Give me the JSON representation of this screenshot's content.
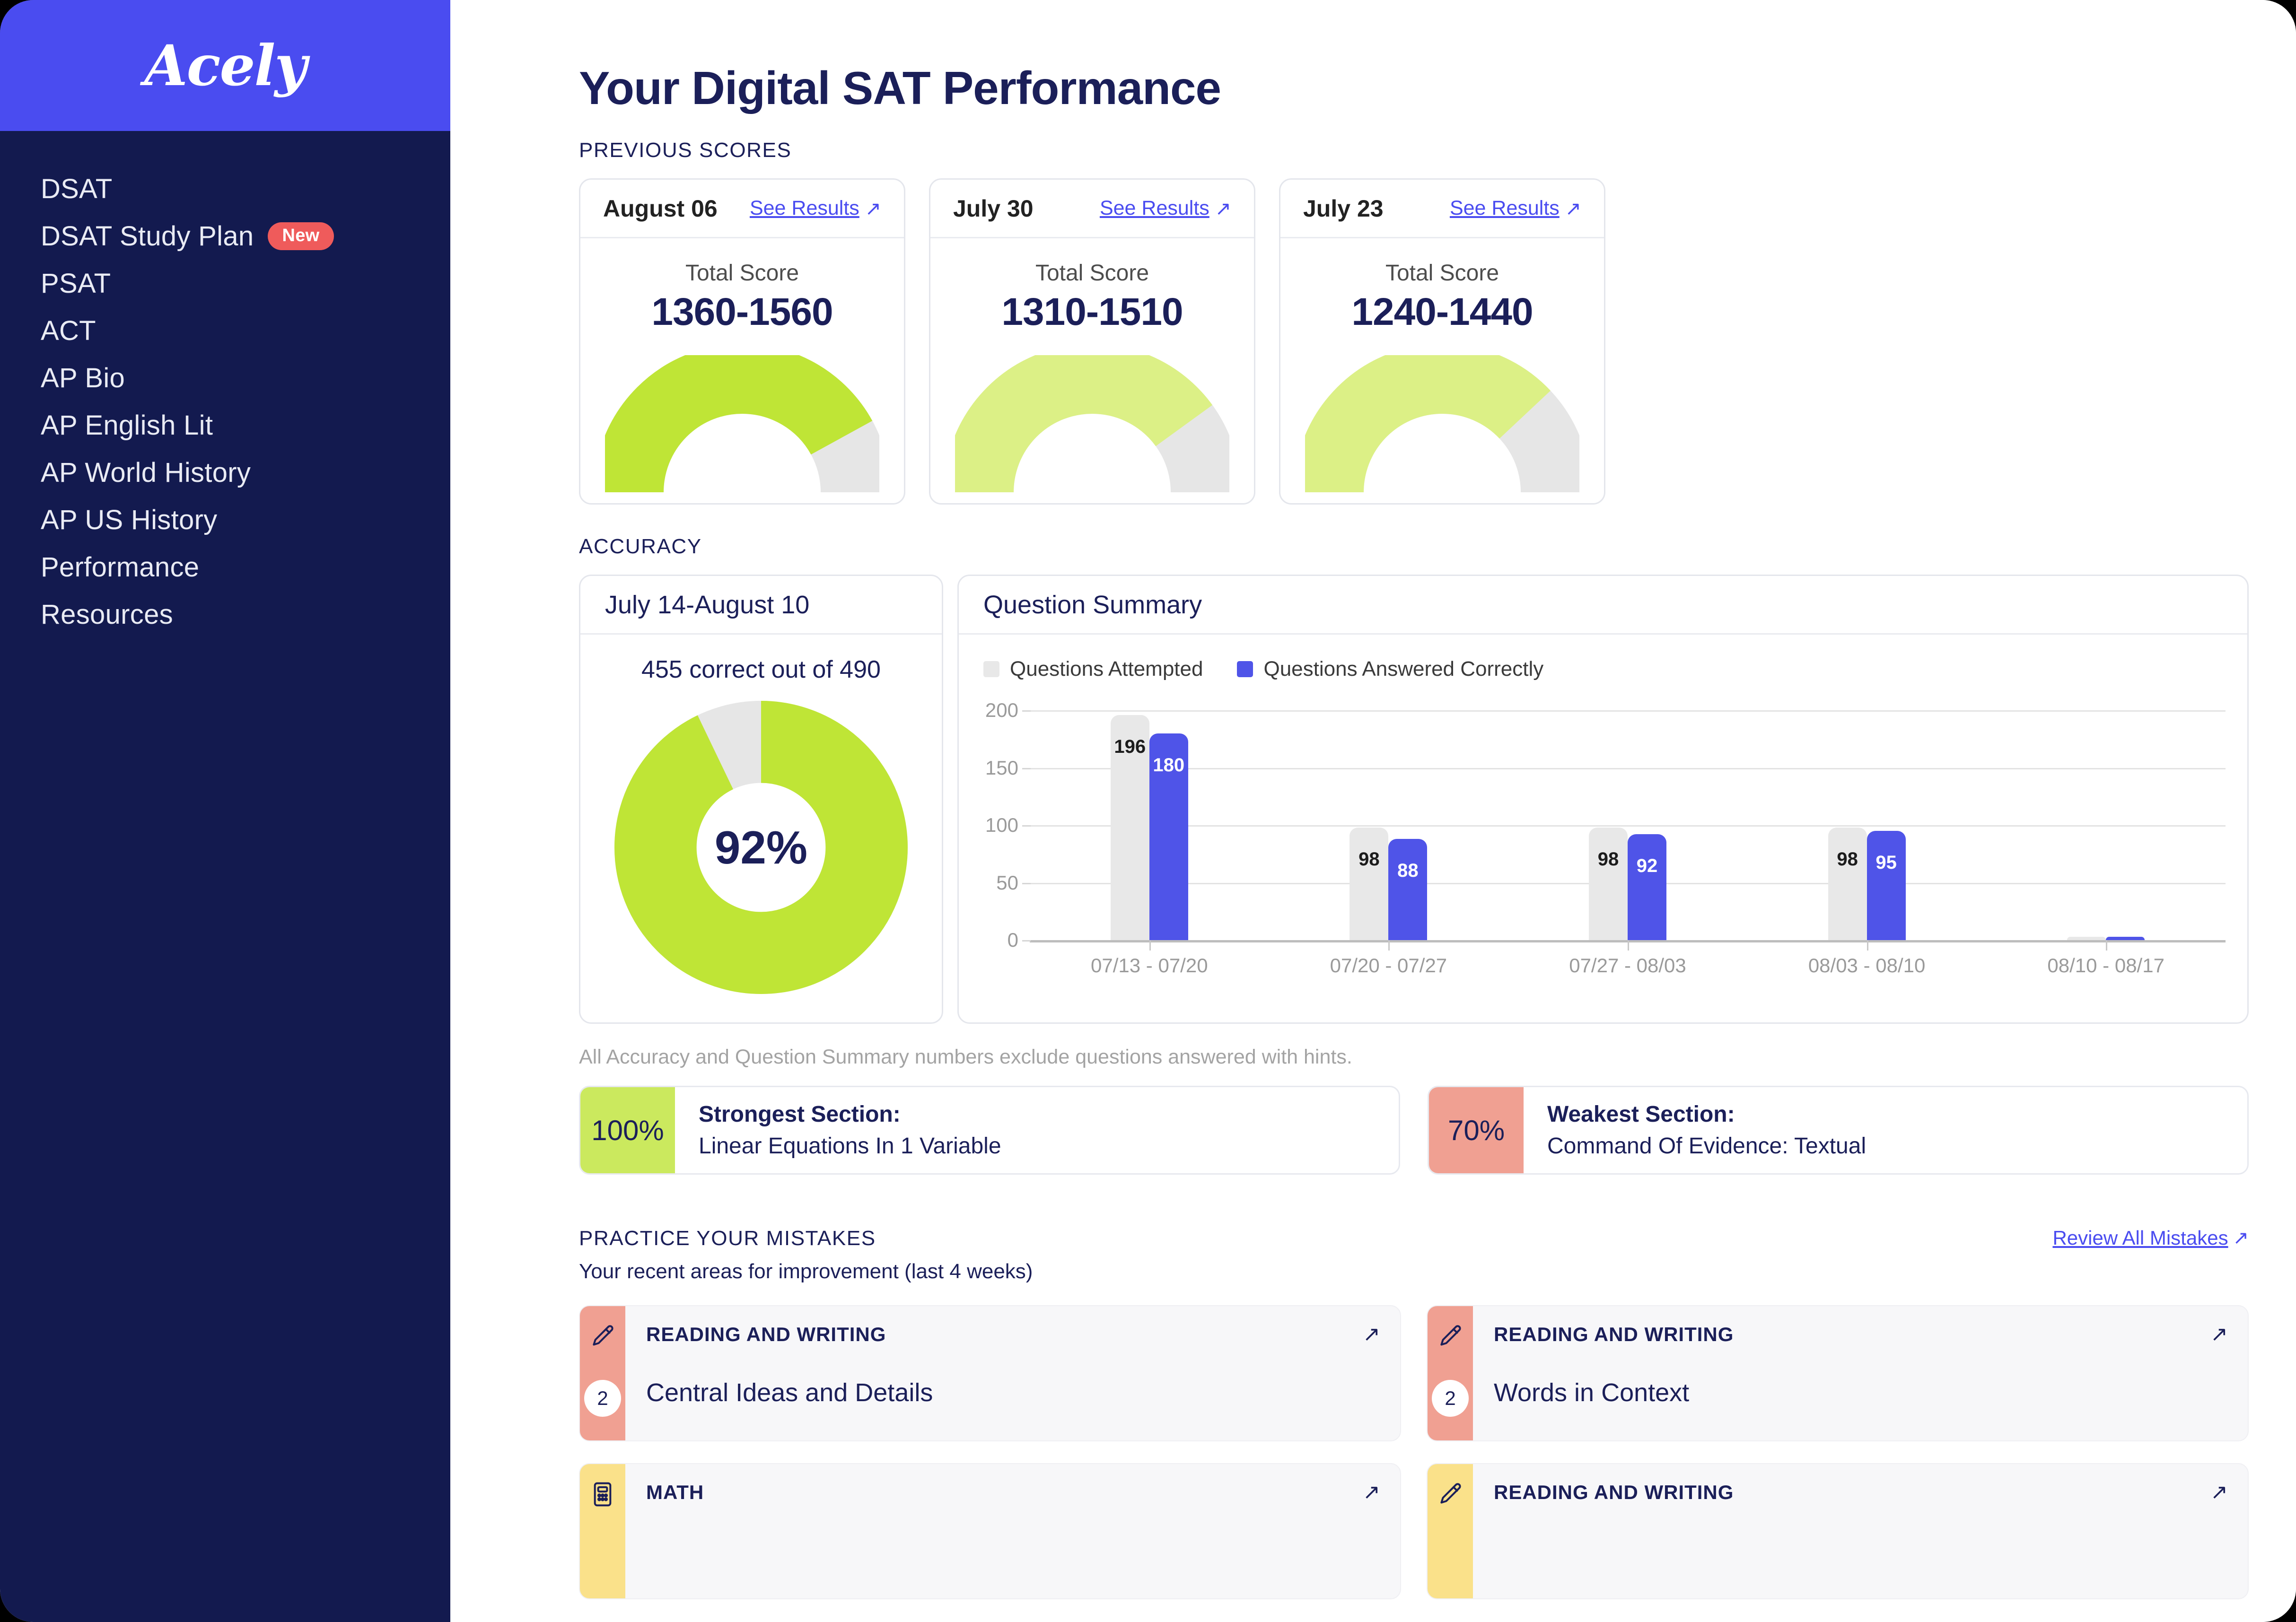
{
  "brand": {
    "logo_text": "Acely",
    "logo_bg": "#4A4CF0",
    "sidebar_bg": "#131A4F"
  },
  "sidebar": {
    "items": [
      {
        "label": "DSAT",
        "badge": null
      },
      {
        "label": "DSAT Study Plan",
        "badge": "New"
      },
      {
        "label": "PSAT",
        "badge": null
      },
      {
        "label": "ACT",
        "badge": null
      },
      {
        "label": "AP Bio",
        "badge": null
      },
      {
        "label": "AP English Lit",
        "badge": null
      },
      {
        "label": "AP World History",
        "badge": null
      },
      {
        "label": "AP US History",
        "badge": null
      },
      {
        "label": "Performance",
        "badge": null
      },
      {
        "label": "Resources",
        "badge": null
      }
    ]
  },
  "header": {
    "title": "Your Digital SAT Performance"
  },
  "previous_scores": {
    "label": "PREVIOUS SCORES",
    "see_results_label": "See Results",
    "total_score_label": "Total Score",
    "cards": [
      {
        "date": "August 06",
        "score": "1360-1560",
        "fill_pct": 84,
        "fill_color": "#BFE536"
      },
      {
        "date": "July 30",
        "score": "1310-1510",
        "fill_pct": 80,
        "fill_color": "#DCF086"
      },
      {
        "date": "July 23",
        "score": "1240-1440",
        "fill_pct": 76,
        "fill_color": "#DCF086"
      }
    ]
  },
  "accuracy": {
    "label": "ACCURACY",
    "date_range": "July 14-August 10",
    "summary": "455 correct out of 490",
    "percent": "92%",
    "correct": 455,
    "total": 490,
    "donut_color": "#BFE536",
    "donut_track": "#E6E6E6"
  },
  "question_summary": {
    "title": "Question Summary",
    "legend": [
      {
        "name": "Questions Attempted",
        "color": "#E8E8E8"
      },
      {
        "name": "Questions Answered Correctly",
        "color": "#4F54E8"
      }
    ]
  },
  "chart_data": {
    "type": "bar",
    "title": "Question Summary",
    "xlabel": "",
    "ylabel": "",
    "ylim": [
      0,
      200
    ],
    "yticks": [
      0,
      50,
      100,
      150,
      200
    ],
    "grid": true,
    "legend_position": "top-left",
    "categories": [
      "07/13 - 07/20",
      "07/20 - 07/27",
      "07/27 - 08/03",
      "08/03 - 08/10",
      "08/10 - 08/17"
    ],
    "series": [
      {
        "name": "Questions Attempted",
        "color": "#E8E8E8",
        "values": [
          196,
          98,
          98,
          98,
          3
        ]
      },
      {
        "name": "Questions Answered Correctly",
        "color": "#4F54E8",
        "values": [
          180,
          88,
          92,
          95,
          3
        ]
      }
    ],
    "data_labels": [
      [
        "196",
        "180"
      ],
      [
        "98",
        "88"
      ],
      [
        "98",
        "92"
      ],
      [
        "98",
        "95"
      ],
      [
        "",
        ""
      ]
    ]
  },
  "hints_note": "All Accuracy and Question Summary numbers exclude questions answered with hints.",
  "sections": [
    {
      "pct": "100%",
      "title": "Strongest Section:",
      "name": "Linear Equations In 1 Variable",
      "color": "#CBE95E"
    },
    {
      "pct": "70%",
      "title": "Weakest Section:",
      "name": "Command Of Evidence: Textual",
      "color": "#F0A092"
    }
  ],
  "practice_mistakes": {
    "label": "PRACTICE YOUR MISTAKES",
    "subtitle": "Your recent areas for improvement (last 4 weeks)",
    "review_link": "Review All Mistakes",
    "cards": [
      {
        "category": "READING AND WRITING",
        "topic": "Central Ideas and Details",
        "count": "2",
        "strip_color": "#F0A092",
        "icon": "pencil-icon"
      },
      {
        "category": "READING AND WRITING",
        "topic": "Words in Context",
        "count": "2",
        "strip_color": "#F0A092",
        "icon": "pencil-icon"
      },
      {
        "category": "MATH",
        "topic": "",
        "count": "",
        "strip_color": "#FAE18A",
        "icon": "calculator-icon"
      },
      {
        "category": "READING AND WRITING",
        "topic": "",
        "count": "",
        "strip_color": "#FAE18A",
        "icon": "pencil-icon"
      }
    ]
  },
  "icons": {
    "arrow_ne": "↗"
  }
}
